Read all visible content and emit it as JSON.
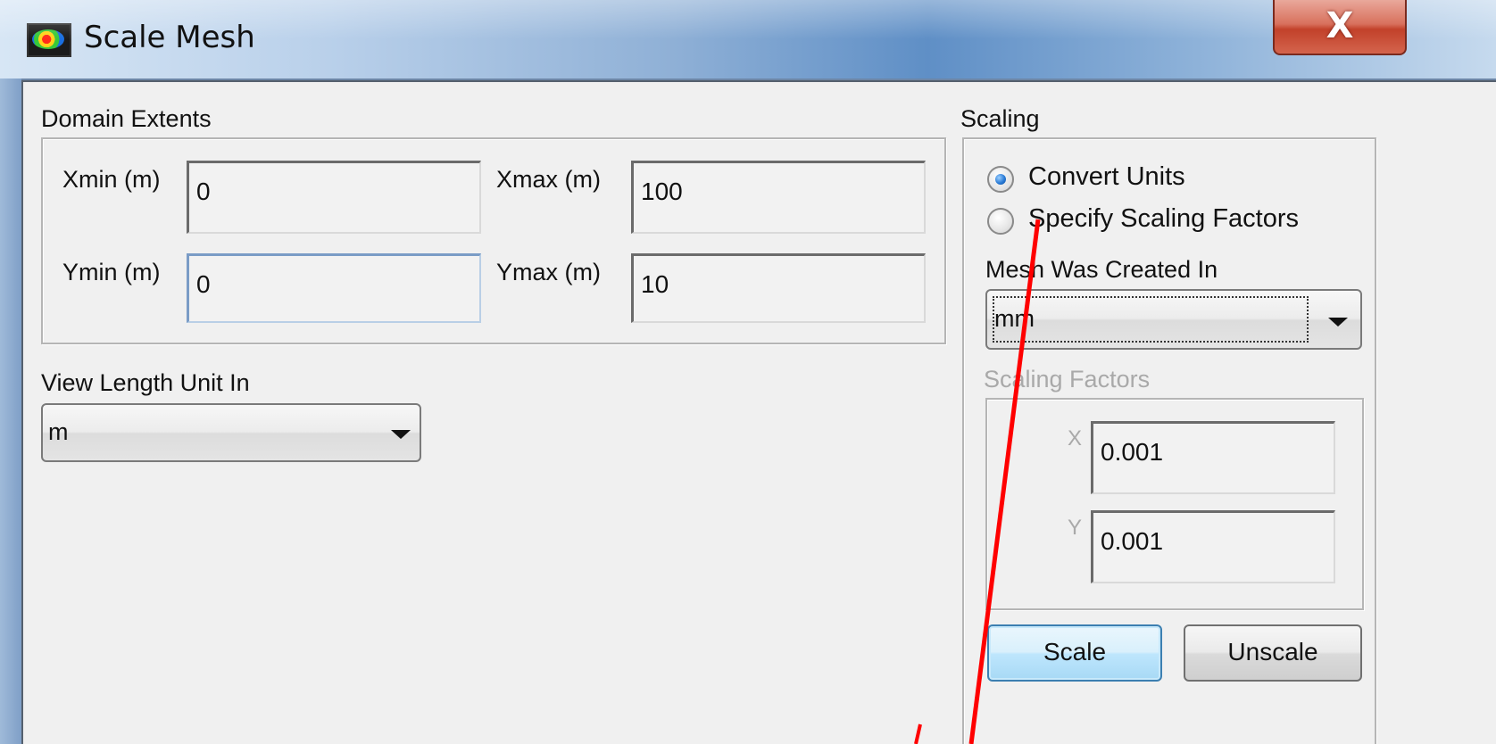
{
  "window": {
    "title": "Scale Mesh",
    "close_label": "X"
  },
  "domain_extents": {
    "label": "Domain Extents",
    "xmin_label": "Xmin (m)",
    "xmin_value": "0",
    "xmax_label": "Xmax (m)",
    "xmax_value": "100",
    "ymin_label": "Ymin (m)",
    "ymin_value": "0",
    "ymax_label": "Ymax (m)",
    "ymax_value": "10"
  },
  "view_length": {
    "label": "View Length Unit In",
    "selected": "m"
  },
  "scaling": {
    "label": "Scaling",
    "options": [
      {
        "label": "Convert Units",
        "selected": true
      },
      {
        "label": "Specify Scaling Factors",
        "selected": false
      }
    ],
    "mesh_created_label": "Mesh Was Created In",
    "mesh_created_value": "mm",
    "factors_label": "Scaling Factors",
    "x_label": "X",
    "x_value": "0.001",
    "y_label": "Y",
    "y_value": "0.001",
    "scale_button": "Scale",
    "unscale_button": "Unscale"
  },
  "colors": {
    "annotation_arrow": "#ff0000",
    "default_button_border": "#3c7fb1",
    "close_button": "#c2412a"
  }
}
